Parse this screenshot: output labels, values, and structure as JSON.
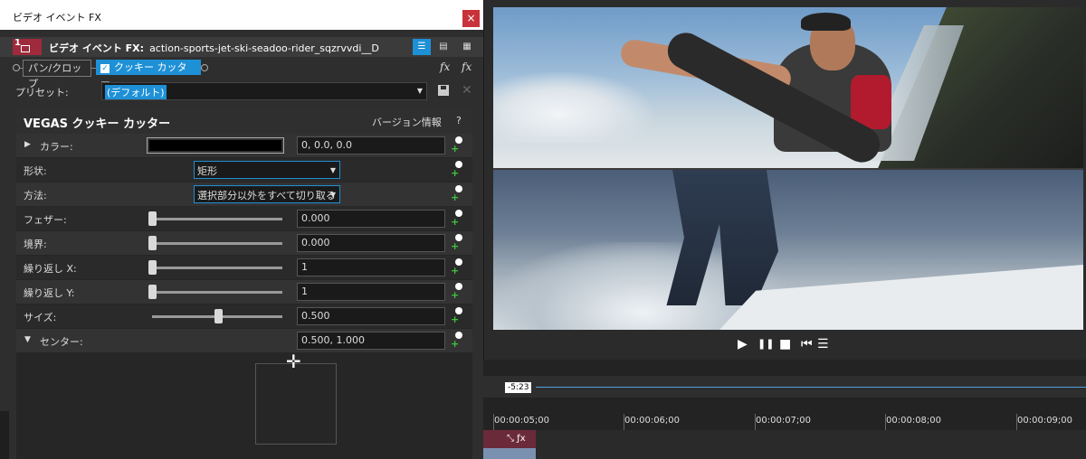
{
  "window": {
    "title": "ビデオ イベント FX",
    "close_label": "×"
  },
  "fx_header": {
    "track_number": "1",
    "label_prefix": "ビデオ イベント FX:",
    "event_name": "action-sports-jet-ski-seadoo-rider_sqzrvvdi__D",
    "view_buttons": [
      "☰",
      "▤",
      "▦"
    ]
  },
  "fx_chain": {
    "items": [
      {
        "label": "パン/クロップ",
        "checked": false,
        "selected": false
      },
      {
        "label": "クッキー カッター",
        "checked": true,
        "selected": true
      }
    ],
    "fx_icons": [
      "fx",
      "fx"
    ]
  },
  "preset": {
    "label": "プリセット:",
    "value": "(デフォルト)"
  },
  "plugin": {
    "title": "VEGAS クッキー カッター",
    "version_link": "バージョン情報",
    "help": "?",
    "params": {
      "color": {
        "label": "カラー:",
        "value": "0, 0.0, 0.0",
        "swatch": "#000000"
      },
      "shape": {
        "label": "形状:",
        "value": "矩形"
      },
      "method": {
        "label": "方法:",
        "value": "選択部分以外をすべて切り取る"
      },
      "feather": {
        "label": "フェザー:",
        "value": "0.000",
        "slider": 0
      },
      "border": {
        "label": "境界:",
        "value": "0.000",
        "slider": 0
      },
      "repeat_x": {
        "label": "繰り返し X:",
        "value": "1",
        "slider": 0
      },
      "repeat_y": {
        "label": "繰り返し Y:",
        "value": "1",
        "slider": 0
      },
      "size": {
        "label": "サイズ:",
        "value": "0.500",
        "slider": 0.5
      },
      "center": {
        "label": "センター:",
        "value": "0.500, 1.000"
      }
    }
  },
  "transport": {
    "buttons": [
      "▶",
      "❚❚",
      "■",
      "⏮",
      "☰"
    ]
  },
  "timeline": {
    "current_time": "-5:23",
    "ruler": [
      "00:00:05;00",
      "00:00:06;00",
      "00:00:07;00",
      "00:00:08;00",
      "00:00:09;00"
    ],
    "clip_icons": "⤡ ƒx"
  },
  "colors": {
    "accent": "#1e90d6",
    "close": "#c8333b",
    "clip": "#6b2a3a",
    "keyframe_plus": "#3ec33e"
  }
}
